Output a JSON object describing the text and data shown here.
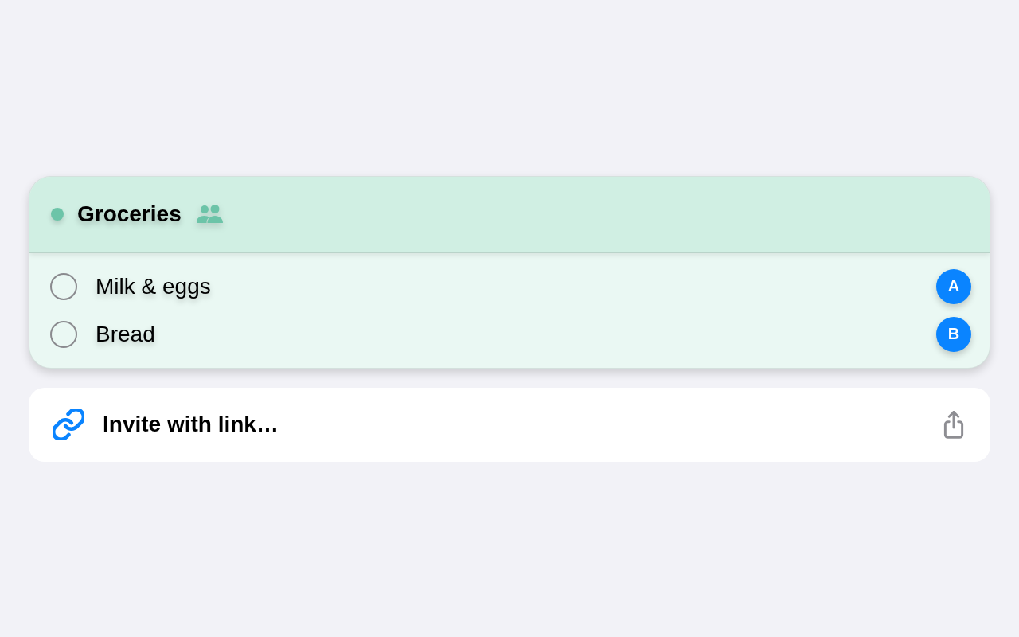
{
  "list": {
    "title": "Groceries",
    "color": "#6cc4a8",
    "shared": true,
    "items": [
      {
        "text": "Milk & eggs",
        "checked": false,
        "assignee": "A"
      },
      {
        "text": "Bread",
        "checked": false,
        "assignee": "B"
      }
    ]
  },
  "invite": {
    "label": "Invite with link…"
  }
}
